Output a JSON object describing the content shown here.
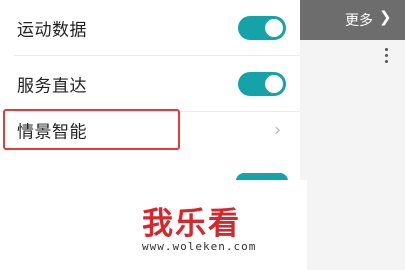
{
  "settings": {
    "items": [
      {
        "label": "运动数据",
        "control": "toggle",
        "state": "on"
      },
      {
        "label": "服务直达",
        "control": "toggle",
        "state": "on"
      },
      {
        "label": "情景智能",
        "control": "chevron"
      }
    ],
    "accent_color": "#14a3a8",
    "highlight_color": "#e33c3c"
  },
  "right_pane": {
    "more_label": "更多",
    "more_icon": "chevron-right-icon",
    "menu_icon": "kebab-menu-icon"
  },
  "watermark": {
    "logo_text": "我乐看",
    "url": "www.woleken.com",
    "color": "#d9262c"
  }
}
